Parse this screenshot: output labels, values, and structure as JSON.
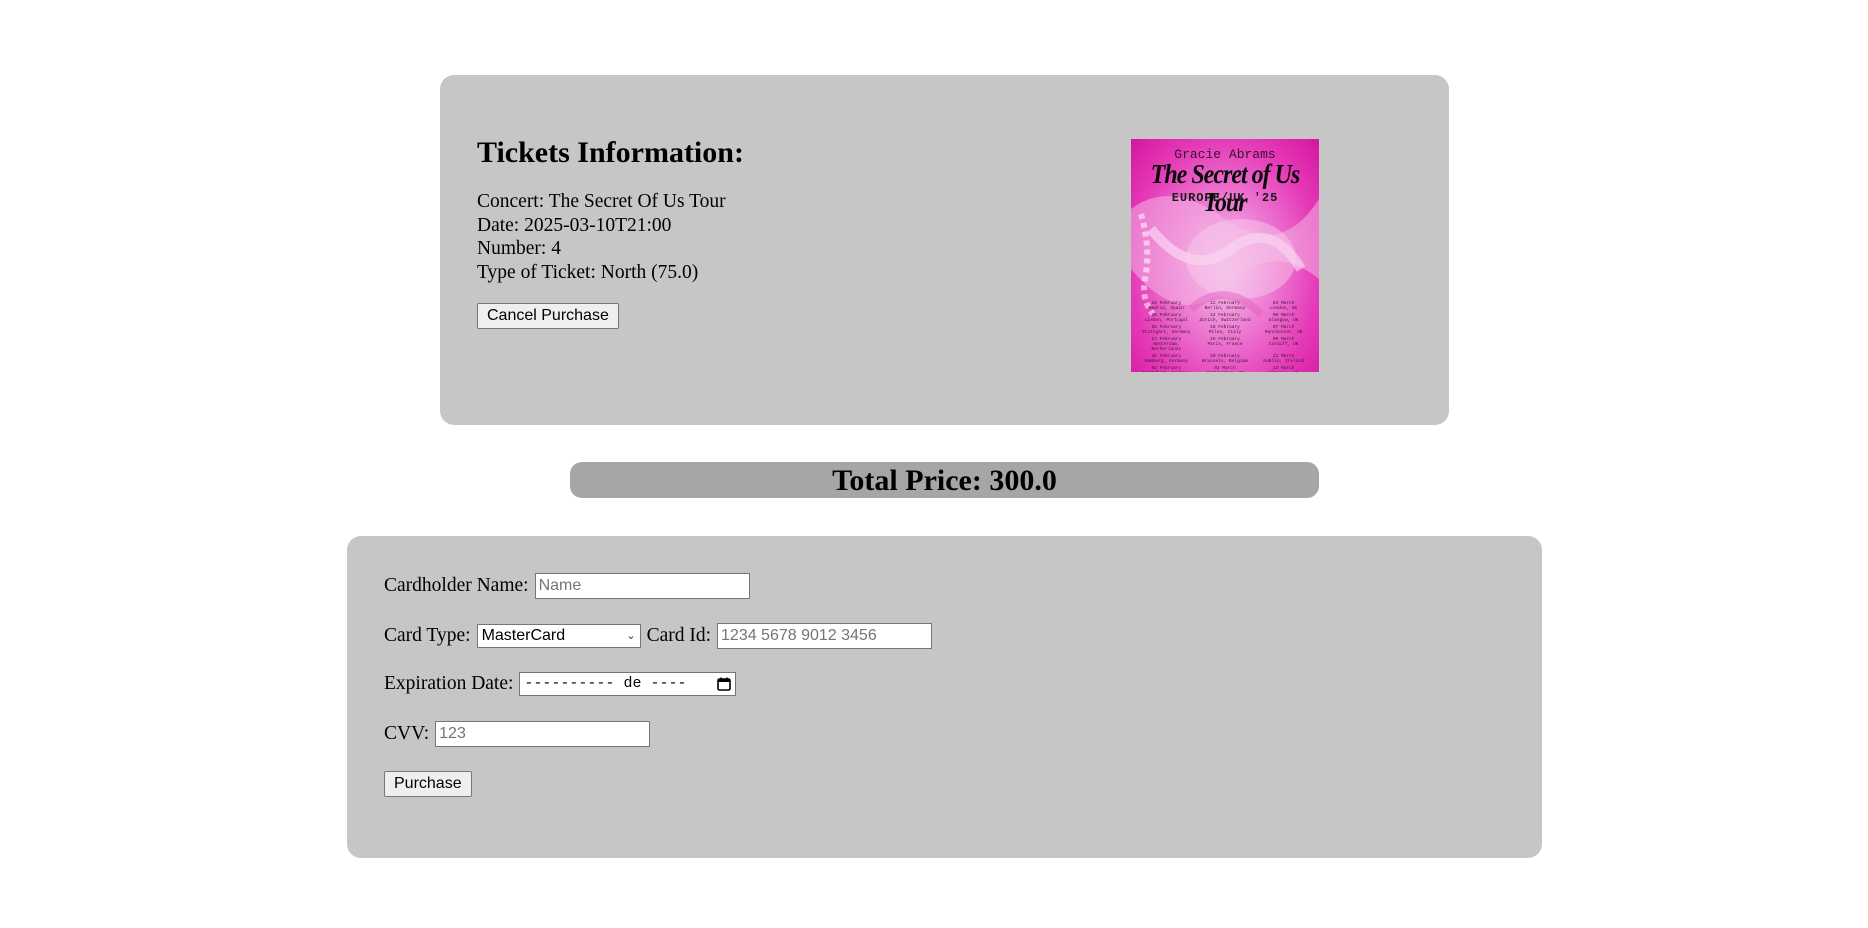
{
  "tickets": {
    "heading": "Tickets Information:",
    "concert": "Concert: The Secret Of Us Tour",
    "date": "Date: 2025-03-10T21:00",
    "number": "Number: 4",
    "type": "Type of Ticket: North (75.0)",
    "cancel_label": "Cancel Purchase"
  },
  "poster": {
    "artist": "Gracie Abrams",
    "title": "The Secret of Us Tour",
    "subtitle": "EUROPE/UK '25",
    "dates": [
      "28 February\nMadrid, Spain",
      "12 February\nBerlin, Germany",
      "04 March\nLondon, UK",
      "25 February\nLisbon, Portugal",
      "14 February\nZurich, Switzerland",
      "06 March\nGlasgow, UK",
      "26 February\nStuttgart, Germany",
      "16 February\nMilan, Italy",
      "07 March\nManchester, UK",
      "27 February\nAmsterdam, Netherlands",
      "18 February\nParis, France",
      "09 March\nCardiff, UK",
      "28 February\nHamburg, Germany",
      "20 February\nBrussels, Belgium",
      "11 March\nDublin, Ireland",
      "02 February\nFrankfurt, Germany",
      "02 March\nNottingham, UK",
      "13 March\nGlasgow, UK"
    ]
  },
  "total": {
    "label": "Total Price: 300.0"
  },
  "payment": {
    "cardholder_label": "Cardholder Name:",
    "cardholder_placeholder": "Name",
    "card_type_label": "Card Type:",
    "card_type_value": "MasterCard",
    "card_id_label": "Card Id:",
    "card_id_placeholder": "1234 5678 9012 3456",
    "expiration_label": "Expiration Date:",
    "expiration_value": "---------- de ----",
    "cvv_label": "CVV:",
    "cvv_placeholder": "123",
    "purchase_label": "Purchase"
  }
}
